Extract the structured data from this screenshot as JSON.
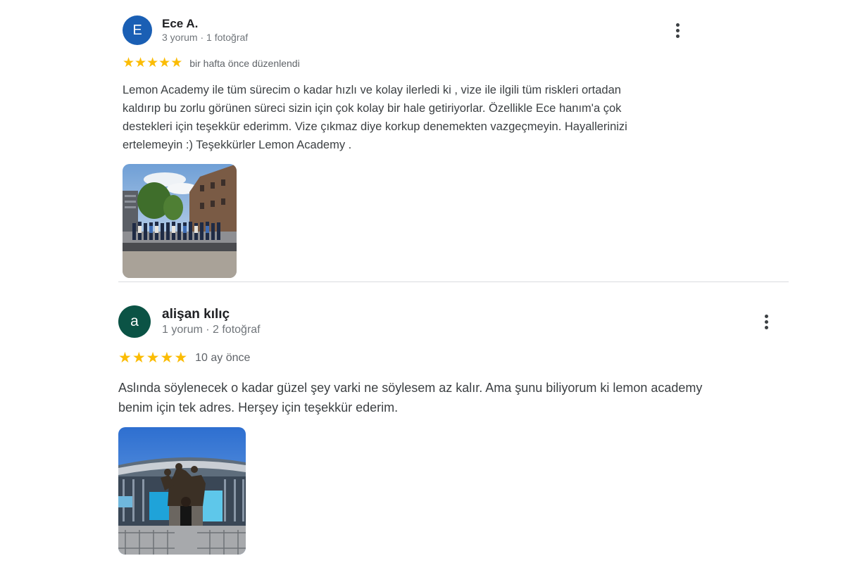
{
  "reviews": [
    {
      "avatar_letter": "E",
      "avatar_color": "#1a5fb4",
      "name": "Ece A.",
      "meta": "3 yorum · 1 fotoğraf",
      "rating": 5,
      "time": "bir hafta önce düzenlendi",
      "text": "Lemon Academy ile tüm sürecim o kadar hızlı ve kolay ilerledi ki , vize ile ilgili tüm riskleri ortadan\nkaldırıp bu zorlu görünen süreci sizin için çok kolay bir hale getiriyorlar. Özellikle Ece hanım'a çok\ndestekleri için teşekkür ederimm. Vize çıkmaz diye korkup denemekten vazgeçmeyin. Hayallerinizi\nertelemeyin :) Teşekkürler Lemon Academy .",
      "more_icon": "more-vert-icon",
      "star_color": "#fbbc04"
    },
    {
      "avatar_letter": "a",
      "avatar_color": "#0b5345",
      "name": "alişan kılıç",
      "meta": "1 yorum · 2 fotoğraf",
      "rating": 5,
      "time": "10 ay önce",
      "text": "Aslında söylenecek o kadar güzel şey varki ne söylesem az kalır. Ama şunu biliyorum ki lemon academy\nbenim için tek adres. Herşey için teşekkür ederim.",
      "more_icon": "more-vert-icon",
      "star_color": "#fbbc04"
    }
  ]
}
